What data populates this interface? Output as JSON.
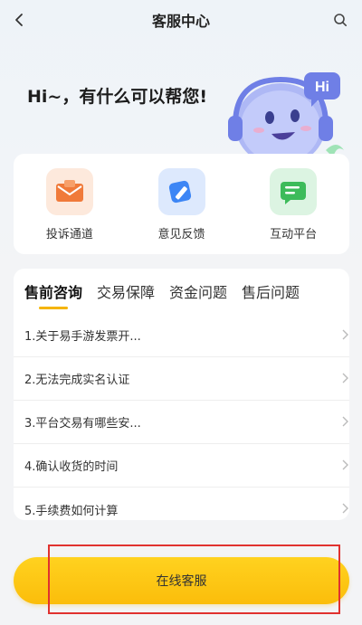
{
  "header": {
    "title": "客服中心",
    "back_icon": "chevron-left-icon",
    "search_icon": "search-icon"
  },
  "hero": {
    "greeting": "Hi~，有什么可以帮您!",
    "mascot_badge": "Hi"
  },
  "quick_actions": [
    {
      "label": "投诉通道",
      "icon": "complaint-envelope-icon",
      "color": "#f07a3a"
    },
    {
      "label": "意见反馈",
      "icon": "feedback-pen-icon",
      "color": "#3d86f5"
    },
    {
      "label": "互动平台",
      "icon": "chat-bubble-icon",
      "color": "#3dbb5a"
    }
  ],
  "faq": {
    "tabs": [
      "售前咨询",
      "交易保障",
      "资金问题",
      "售后问题"
    ],
    "active_tab": 0,
    "items": [
      "1.关于易手游发票开...",
      "2.无法完成实名认证",
      "3.平台交易有哪些安...",
      "4.确认收货的时间",
      "5.手续费如何计算"
    ]
  },
  "cta": {
    "label": "在线客服",
    "accent": "#fcc414"
  },
  "annotation": {
    "highlight_color": "#e0322f"
  }
}
